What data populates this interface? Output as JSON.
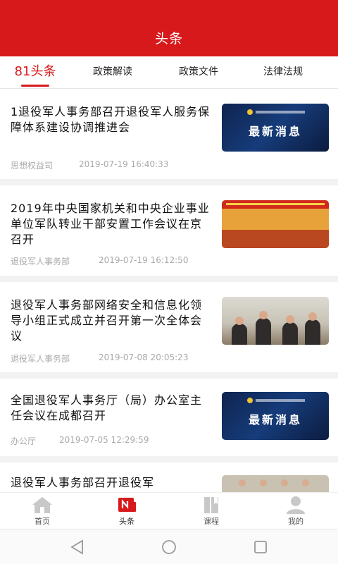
{
  "header": {
    "title": "头条"
  },
  "tabs": [
    {
      "label": "81头条",
      "active": true
    },
    {
      "label": "政策解读",
      "active": false
    },
    {
      "label": "政策文件",
      "active": false
    },
    {
      "label": "法律法规",
      "active": false
    }
  ],
  "articles": [
    {
      "title": "1退役军人事务部召开退役军人服务保障体系建设协调推进会",
      "source": "思想权益司",
      "date": "2019-07-19 16:40:33",
      "thumb": "最新消息"
    },
    {
      "title": "2019年中央国家机关和中央企业事业单位军队转业干部安置工作会议在京召开",
      "source": "退役军人事务部",
      "date": "2019-07-19 16:12:50",
      "thumb": ""
    },
    {
      "title": "退役军人事务部网络安全和信息化领导小组正式成立并召开第一次全体会议",
      "source": "退役军人事务部",
      "date": "2019-07-08 20:05:23",
      "thumb": ""
    },
    {
      "title": "全国退役军人事务厅（局）办公室主任会议在成都召开",
      "source": "办公厅",
      "date": "2019-07-05 12:29:59",
      "thumb": "最新消息"
    },
    {
      "title": "退役军人事务部召开退役军",
      "source": "",
      "date": "",
      "thumb": ""
    }
  ],
  "bottom_nav": [
    {
      "label": "首页",
      "icon": "home-icon",
      "active": false
    },
    {
      "label": "头条",
      "icon": "news-icon",
      "active": true
    },
    {
      "label": "课程",
      "icon": "book-icon",
      "active": false
    },
    {
      "label": "我的",
      "icon": "profile-icon",
      "active": false
    }
  ],
  "colors": {
    "accent": "#d7191c",
    "nav_icon_inactive": "#c8c8c8"
  }
}
